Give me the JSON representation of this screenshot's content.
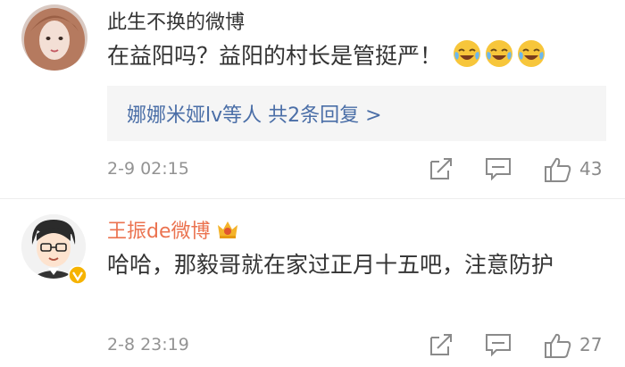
{
  "comments": [
    {
      "username": "此生不换的微博",
      "text": "在益阳吗？益阳的村长是管挺严！",
      "emoji": [
        "laugh-cry-emoji",
        "laugh-cry-emoji",
        "laugh-cry-emoji"
      ],
      "replies_summary": "娜娜米娅lv等人  共2条回复 >",
      "time": "2-9 02:15",
      "likes": "43"
    },
    {
      "username": "王振de微博",
      "text": "哈哈，那毅哥就在家过正月十五吧，注意防护",
      "time": "2-8 23:19",
      "likes": "27"
    }
  ],
  "icons": [
    "share-icon",
    "comment-icon",
    "like-icon",
    "vip-crown-icon",
    "verified-badge-icon"
  ],
  "colors": {
    "username_highlight": "#eb7350",
    "link": "#4a6ea7",
    "meta": "#939393"
  }
}
